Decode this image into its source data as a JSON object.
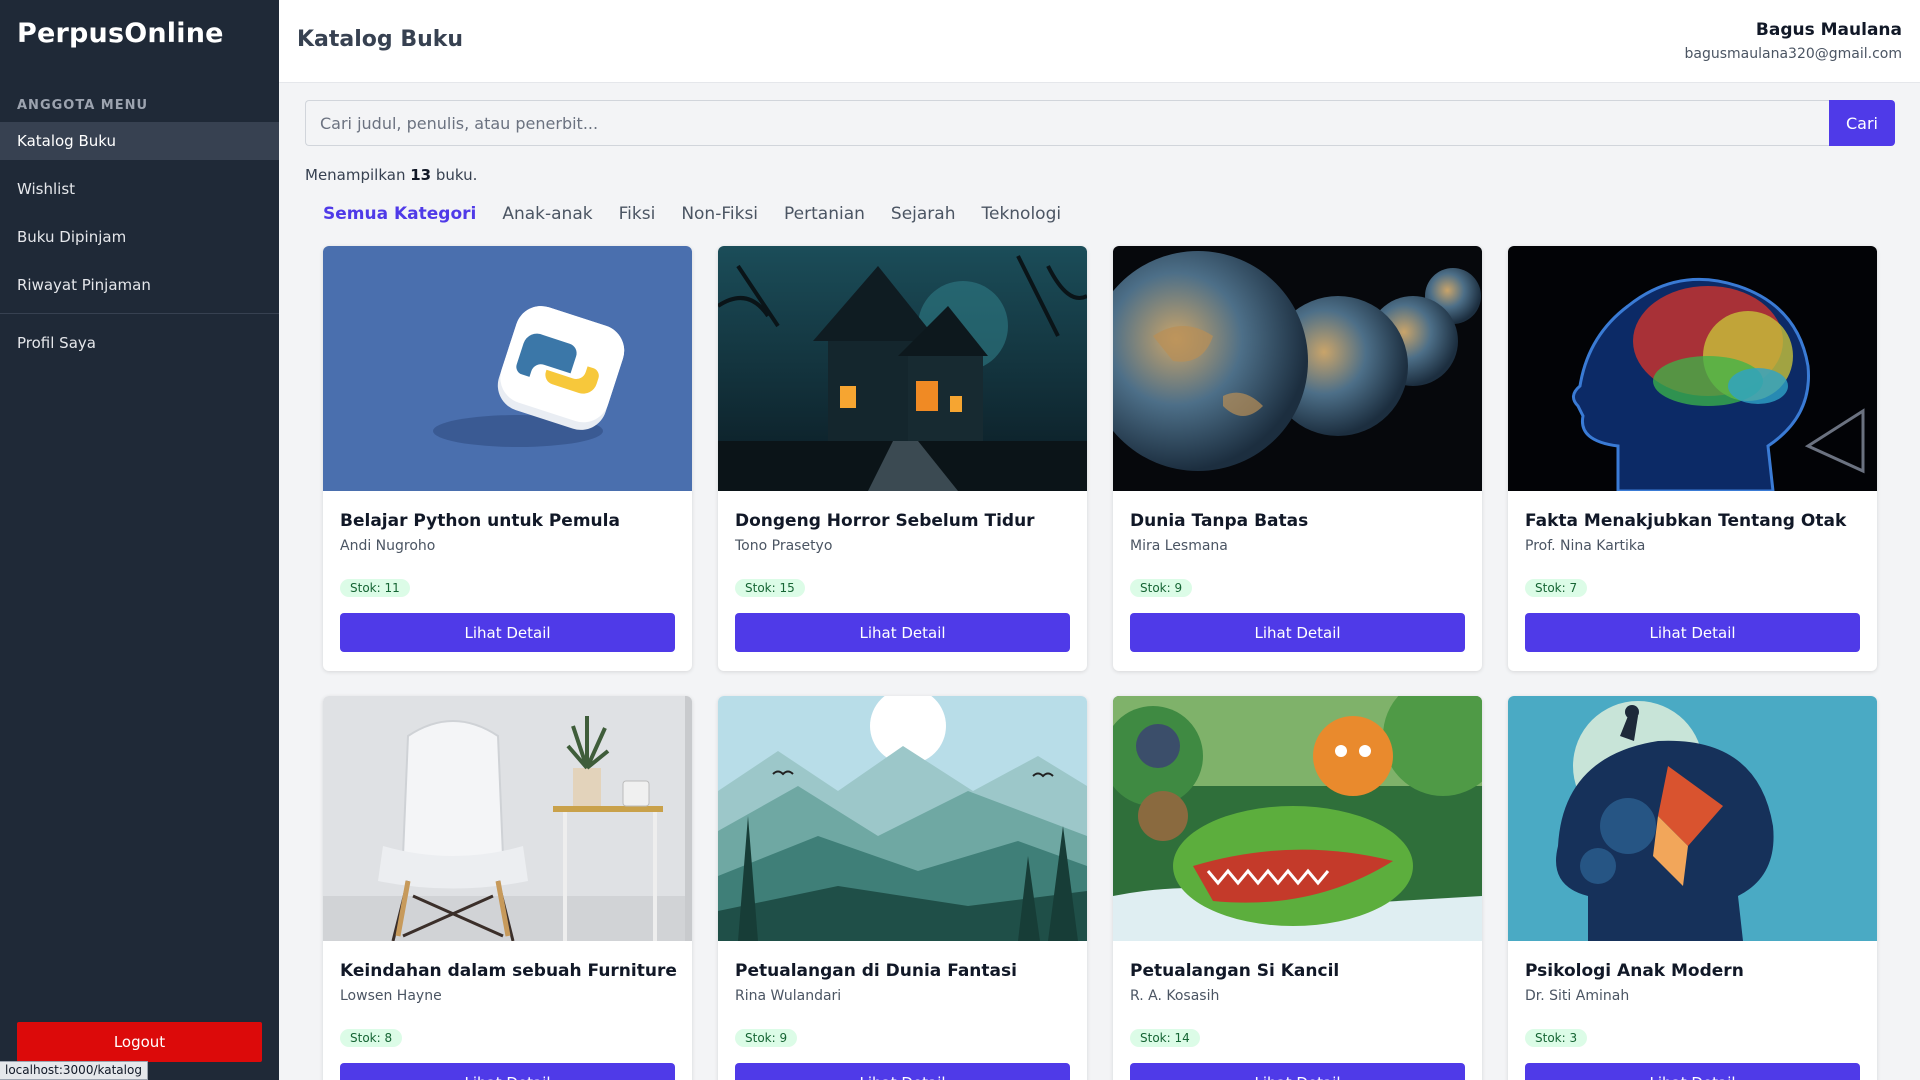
{
  "app": {
    "brand": "PerpusOnline"
  },
  "sidebar": {
    "heading": "ANGGOTA MENU",
    "items": [
      {
        "label": "Katalog Buku"
      },
      {
        "label": "Wishlist"
      },
      {
        "label": "Buku Dipinjam"
      },
      {
        "label": "Riwayat Pinjaman"
      },
      {
        "label": "Profil Saya"
      }
    ],
    "logout_label": "Logout"
  },
  "status_bar": {
    "url": "localhost:3000/katalog"
  },
  "header": {
    "title": "Katalog Buku",
    "user_name": "Bagus Maulana",
    "user_email": "bagusmaulana320@gmail.com"
  },
  "search": {
    "placeholder": "Cari judul, penulis, atau penerbit...",
    "button_label": "Cari"
  },
  "results": {
    "prefix": "Menampilkan",
    "count": "13",
    "suffix": "buku."
  },
  "categories": [
    {
      "label": "Semua Kategori"
    },
    {
      "label": "Anak-anak"
    },
    {
      "label": "Fiksi"
    },
    {
      "label": "Non-Fiksi"
    },
    {
      "label": "Pertanian"
    },
    {
      "label": "Sejarah"
    },
    {
      "label": "Teknologi"
    }
  ],
  "books": [
    {
      "title": "Belajar Python untuk Pemula",
      "author": "Andi Nugroho",
      "stock": "Stok: 11",
      "button": "Lihat Detail"
    },
    {
      "title": "Dongeng Horror Sebelum Tidur",
      "author": "Tono Prasetyo",
      "stock": "Stok: 15",
      "button": "Lihat Detail"
    },
    {
      "title": "Dunia Tanpa Batas",
      "author": "Mira Lesmana",
      "stock": "Stok: 9",
      "button": "Lihat Detail"
    },
    {
      "title": "Fakta Menakjubkan Tentang Otak",
      "author": "Prof. Nina Kartika",
      "stock": "Stok: 7",
      "button": "Lihat Detail"
    },
    {
      "title": "Keindahan dalam sebuah Furniture",
      "author": "Lowsen Hayne",
      "stock": "Stok: 8",
      "button": "Lihat Detail"
    },
    {
      "title": "Petualangan di Dunia Fantasi",
      "author": "Rina Wulandari",
      "stock": "Stok: 9",
      "button": "Lihat Detail"
    },
    {
      "title": "Petualangan Si Kancil",
      "author": "R. A. Kosasih",
      "stock": "Stok: 14",
      "button": "Lihat Detail"
    },
    {
      "title": "Psikologi Anak Modern",
      "author": "Dr. Siti Aminah",
      "stock": "Stok: 3",
      "button": "Lihat Detail"
    }
  ],
  "colors": {
    "sidebar": "#1f2937",
    "accent": "#4f3ae8",
    "logout": "#dc0a0a",
    "stock_bg": "#dcfce7",
    "stock_text": "#166534"
  }
}
